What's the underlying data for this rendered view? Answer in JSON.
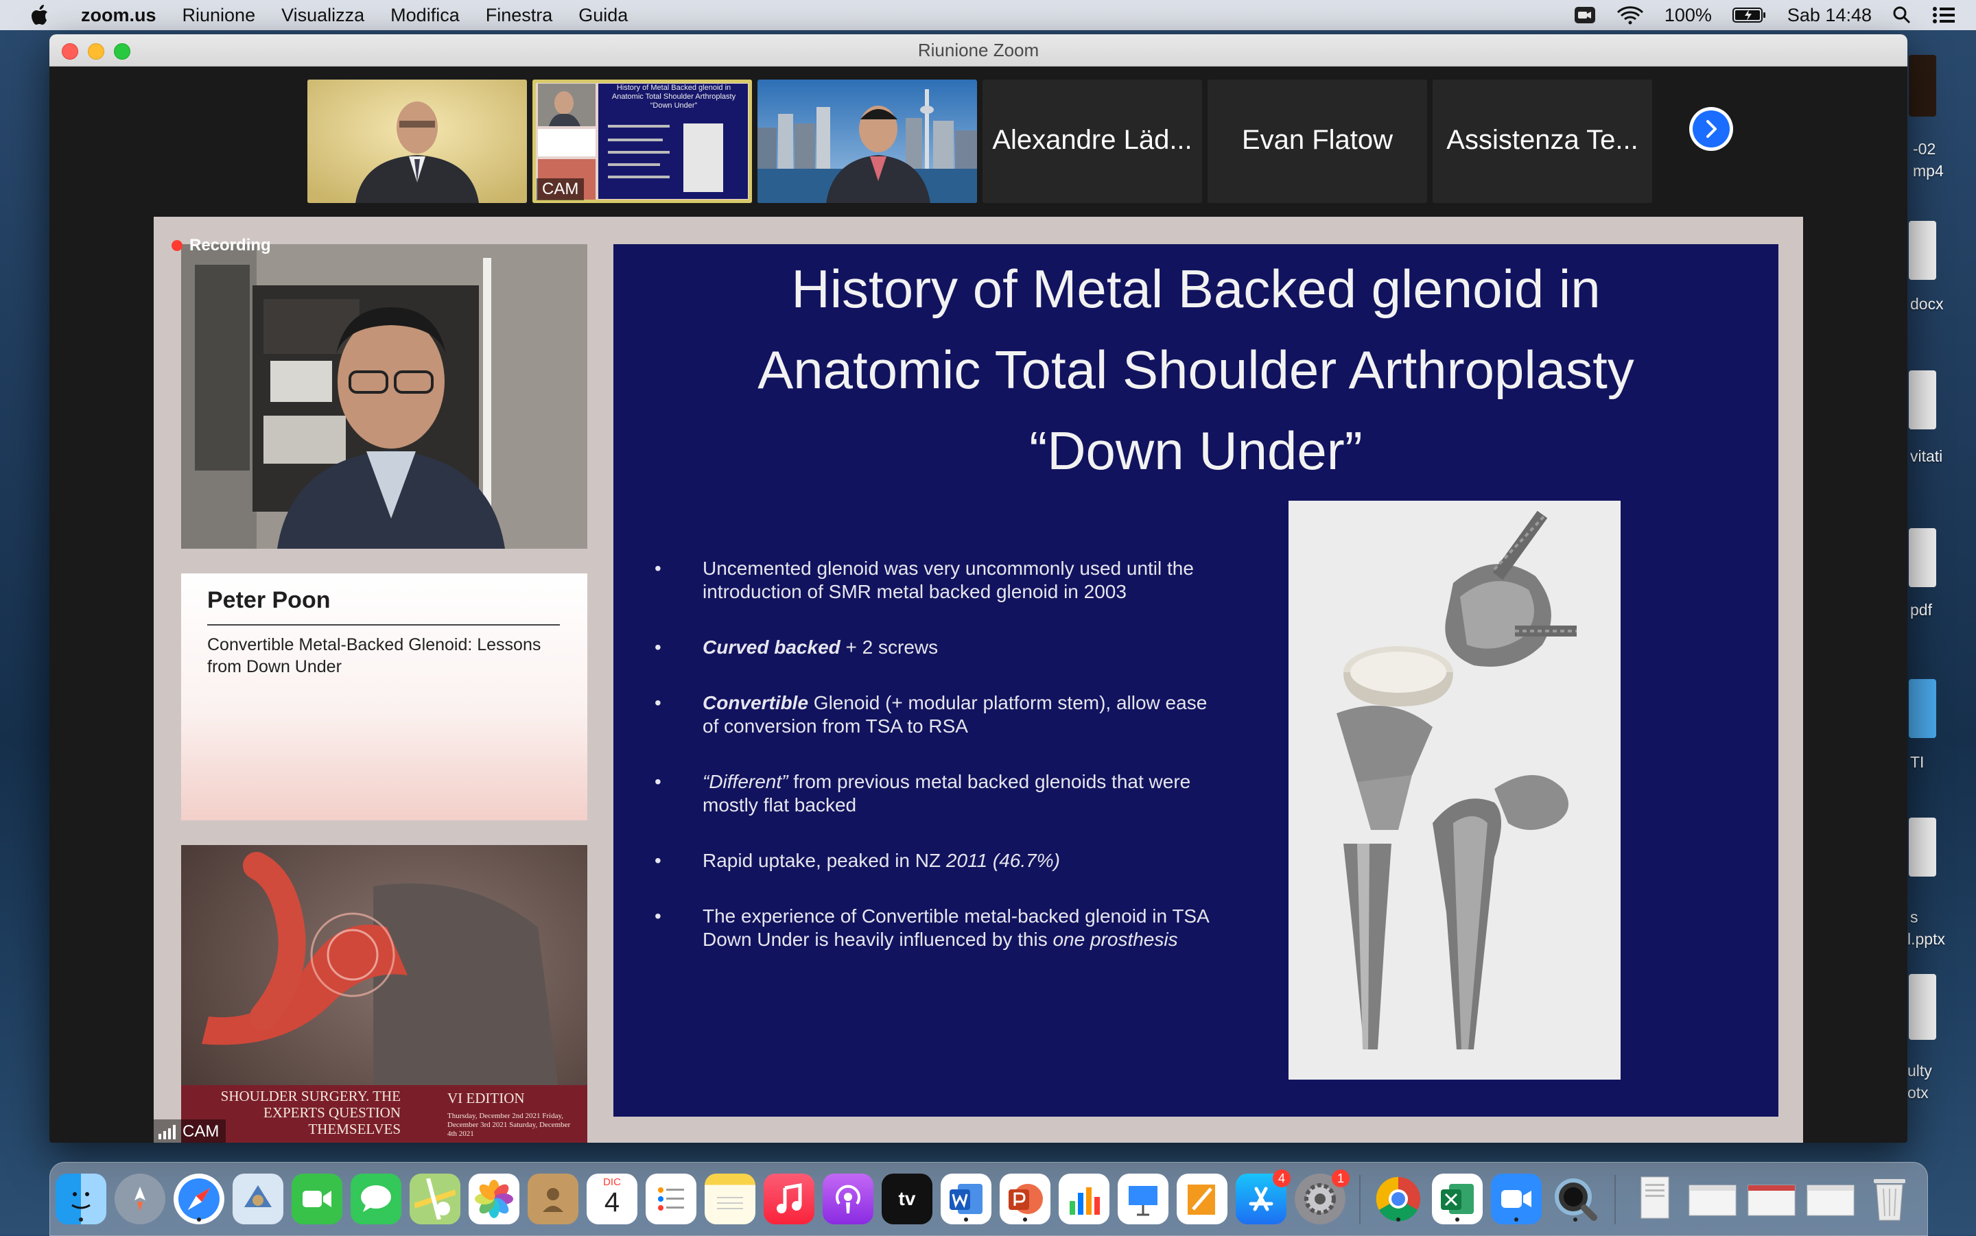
{
  "menubar": {
    "app": "zoom.us",
    "menus": [
      "Riunione",
      "Visualizza",
      "Modifica",
      "Finestra",
      "Guida"
    ],
    "battery": "100%",
    "clock": "Sab 14:48"
  },
  "desktop_files": [
    "-02",
    "mp4",
    "docx",
    "vitati",
    "pdf",
    "TI",
    "s",
    "l.pptx",
    "ulty",
    "otx"
  ],
  "window": {
    "title": "Riunione Zoom"
  },
  "participants": [
    {
      "name": "Alexandre Läd..."
    },
    {
      "name": "Evan Flatow"
    },
    {
      "name": "Assistenza Te..."
    }
  ],
  "video_tiles": {
    "cam_tag": "CAM",
    "mini_slide_title": "History of Metal Backed glenoid in Anatomic Total Shoulder Arthroplasty “Down Under”"
  },
  "main": {
    "recording_label": "Recording",
    "cam_label": "CAM",
    "speaker_name": "Peter Poon",
    "talk_title": "Convertible Metal-Backed Glenoid: Lessons from Down Under",
    "poster_left": "SHOULDER SURGERY. THE EXPERTS QUESTION THEMSELVES",
    "poster_right": "VI EDITION",
    "poster_dates": "Thursday, December 2nd 2021 Friday, December 3rd 2021 Saturday, December 4th 2021"
  },
  "slide": {
    "title_line1": "History of Metal Backed glenoid in",
    "title_line2": "Anatomic Total Shoulder Arthroplasty",
    "title_line3": "“Down Under”",
    "b1": "Uncemented glenoid was very uncommonly used until the introduction of SMR metal backed glenoid in 2003",
    "b2_em": "Curved backed",
    "b2_rest": " + 2 screws",
    "b3_em": "Convertible",
    "b3_rest": " Glenoid (+ modular platform stem), allow ease of conversion from TSA to RSA",
    "b4_em": "“Different”",
    "b4_rest": " from previous metal backed glenoids that were mostly flat backed",
    "b5_pre": "Rapid uptake, peaked in NZ ",
    "b5_em": "2011 (46.7%)",
    "b6_pre": "The experience of Convertible metal-backed glenoid in TSA Down Under is heavily influenced by this ",
    "b6_em": "one prosthesis"
  },
  "dock": {
    "calendar_month": "DIC",
    "calendar_day": "4",
    "appstore_badge": "4",
    "settings_badge": "1"
  }
}
